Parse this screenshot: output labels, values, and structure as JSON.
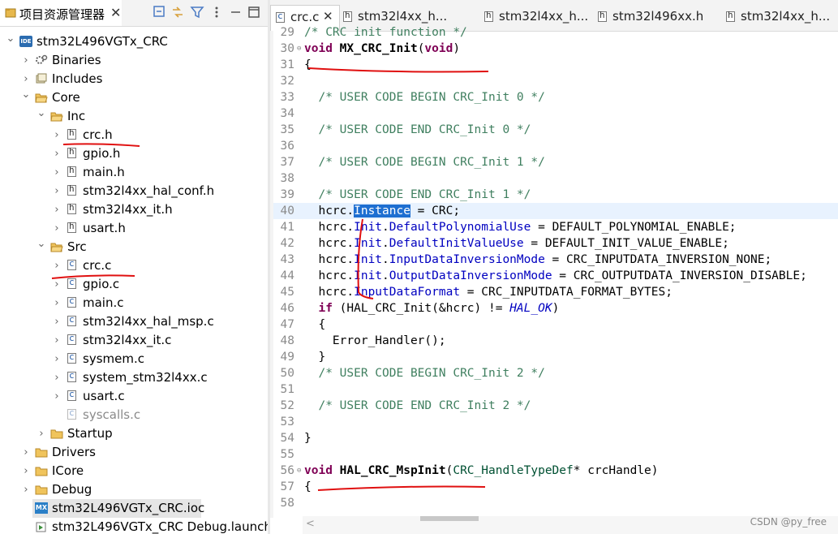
{
  "explorer": {
    "title": "项目资源管理器",
    "close": "✕",
    "tree": [
      {
        "label": "stm32L496VGTx_CRC",
        "icon": "ide",
        "depth": 0,
        "twisty": "v"
      },
      {
        "label": "Binaries",
        "icon": "binaries",
        "depth": 1,
        "twisty": ">"
      },
      {
        "label": "Includes",
        "icon": "includes",
        "depth": 1,
        "twisty": ">"
      },
      {
        "label": "Core",
        "icon": "folder-open",
        "depth": 1,
        "twisty": "v"
      },
      {
        "label": "Inc",
        "icon": "folder-open",
        "depth": 2,
        "twisty": "v"
      },
      {
        "label": "crc.h",
        "icon": "h",
        "depth": 3,
        "twisty": ">"
      },
      {
        "label": "gpio.h",
        "icon": "h",
        "depth": 3,
        "twisty": ">"
      },
      {
        "label": "main.h",
        "icon": "h",
        "depth": 3,
        "twisty": ">"
      },
      {
        "label": "stm32l4xx_hal_conf.h",
        "icon": "h",
        "depth": 3,
        "twisty": ">"
      },
      {
        "label": "stm32l4xx_it.h",
        "icon": "h",
        "depth": 3,
        "twisty": ">"
      },
      {
        "label": "usart.h",
        "icon": "h",
        "depth": 3,
        "twisty": ">"
      },
      {
        "label": "Src",
        "icon": "folder-open",
        "depth": 2,
        "twisty": "v"
      },
      {
        "label": "crc.c",
        "icon": "c",
        "depth": 3,
        "twisty": ">"
      },
      {
        "label": "gpio.c",
        "icon": "c",
        "depth": 3,
        "twisty": ">"
      },
      {
        "label": "main.c",
        "icon": "c",
        "depth": 3,
        "twisty": ">"
      },
      {
        "label": "stm32l4xx_hal_msp.c",
        "icon": "c",
        "depth": 3,
        "twisty": ">"
      },
      {
        "label": "stm32l4xx_it.c",
        "icon": "c",
        "depth": 3,
        "twisty": ">"
      },
      {
        "label": "sysmem.c",
        "icon": "c",
        "depth": 3,
        "twisty": ">"
      },
      {
        "label": "system_stm32l4xx.c",
        "icon": "c",
        "depth": 3,
        "twisty": ">"
      },
      {
        "label": "usart.c",
        "icon": "c",
        "depth": 3,
        "twisty": ">"
      },
      {
        "label": "syscalls.c",
        "icon": "c-excluded",
        "depth": 3,
        "twisty": ""
      },
      {
        "label": "Startup",
        "icon": "folder",
        "depth": 2,
        "twisty": ">"
      },
      {
        "label": "Drivers",
        "icon": "folder",
        "depth": 1,
        "twisty": ">"
      },
      {
        "label": "ICore",
        "icon": "folder",
        "depth": 1,
        "twisty": ">"
      },
      {
        "label": "Debug",
        "icon": "folder",
        "depth": 1,
        "twisty": ">"
      },
      {
        "label": "stm32L496VGTx_CRC.ioc",
        "icon": "mx",
        "depth": 1,
        "twisty": "",
        "selected": true
      },
      {
        "label": "stm32L496VGTx_CRC Debug.launch",
        "icon": "launch",
        "depth": 1,
        "twisty": ""
      }
    ]
  },
  "editor": {
    "tabs": [
      {
        "label": "crc.c",
        "icon": "c",
        "active": true,
        "close": "✕"
      },
      {
        "label": "stm32l4xx_h...",
        "icon": "h"
      },
      {
        "label": "stm32l4xx_h...",
        "icon": "h"
      },
      {
        "label": "stm32l496xx.h",
        "icon": "h"
      },
      {
        "label": "stm32l4xx_h...",
        "icon": "h"
      }
    ],
    "lines": [
      {
        "n": "29",
        "fold": "",
        "segs": [
          [
            "cmt",
            "/* CRC init function */"
          ]
        ]
      },
      {
        "n": "30",
        "fold": "⊖",
        "segs": [
          [
            "kw",
            "void"
          ],
          [
            "",
            " "
          ],
          [
            "fnb",
            "MX_CRC_Init"
          ],
          [
            "",
            "("
          ],
          [
            "kw",
            "void"
          ],
          [
            "",
            ")"
          ]
        ]
      },
      {
        "n": "31",
        "fold": "",
        "segs": [
          [
            "",
            "{"
          ]
        ]
      },
      {
        "n": "32",
        "fold": "",
        "segs": []
      },
      {
        "n": "33",
        "fold": "",
        "segs": [
          [
            "",
            "  "
          ],
          [
            "cmt",
            "/* USER CODE BEGIN CRC_Init 0 */"
          ]
        ]
      },
      {
        "n": "34",
        "fold": "",
        "segs": []
      },
      {
        "n": "35",
        "fold": "",
        "segs": [
          [
            "",
            "  "
          ],
          [
            "cmt",
            "/* USER CODE END CRC_Init 0 */"
          ]
        ]
      },
      {
        "n": "36",
        "fold": "",
        "segs": []
      },
      {
        "n": "37",
        "fold": "",
        "segs": [
          [
            "",
            "  "
          ],
          [
            "cmt",
            "/* USER CODE BEGIN CRC_Init 1 */"
          ]
        ]
      },
      {
        "n": "38",
        "fold": "",
        "segs": []
      },
      {
        "n": "39",
        "fold": "",
        "segs": [
          [
            "",
            "  "
          ],
          [
            "cmt",
            "/* USER CODE END CRC_Init 1 */"
          ]
        ]
      },
      {
        "n": "40",
        "fold": "",
        "current": true,
        "segs": [
          [
            "",
            "  hcrc."
          ],
          [
            "hl",
            "Instance"
          ],
          [
            "",
            " = CRC;"
          ]
        ]
      },
      {
        "n": "41",
        "fold": "",
        "segs": [
          [
            "",
            "  hcrc."
          ],
          [
            "fld",
            "Init"
          ],
          [
            "",
            "."
          ],
          [
            "fld",
            "DefaultPolynomialUse"
          ],
          [
            "",
            " = DEFAULT_POLYNOMIAL_ENABLE;"
          ]
        ]
      },
      {
        "n": "42",
        "fold": "",
        "segs": [
          [
            "",
            "  hcrc."
          ],
          [
            "fld",
            "Init"
          ],
          [
            "",
            "."
          ],
          [
            "fld",
            "DefaultInitValueUse"
          ],
          [
            "",
            " = DEFAULT_INIT_VALUE_ENABLE;"
          ]
        ]
      },
      {
        "n": "43",
        "fold": "",
        "segs": [
          [
            "",
            "  hcrc."
          ],
          [
            "fld",
            "Init"
          ],
          [
            "",
            "."
          ],
          [
            "fld",
            "InputDataInversionMode"
          ],
          [
            "",
            " = CRC_INPUTDATA_INVERSION_NONE;"
          ]
        ]
      },
      {
        "n": "44",
        "fold": "",
        "segs": [
          [
            "",
            "  hcrc."
          ],
          [
            "fld",
            "Init"
          ],
          [
            "",
            "."
          ],
          [
            "fld",
            "OutputDataInversionMode"
          ],
          [
            "",
            " = CRC_OUTPUTDATA_INVERSION_DISABLE;"
          ]
        ]
      },
      {
        "n": "45",
        "fold": "",
        "segs": [
          [
            "",
            "  hcrc."
          ],
          [
            "fld",
            "InputDataFormat"
          ],
          [
            "",
            " = CRC_INPUTDATA_FORMAT_BYTES;"
          ]
        ]
      },
      {
        "n": "46",
        "fold": "",
        "segs": [
          [
            "",
            "  "
          ],
          [
            "kw",
            "if"
          ],
          [
            "",
            " (HAL_CRC_Init(&hcrc) != "
          ],
          [
            "hal",
            "HAL_OK"
          ],
          [
            "",
            ")"
          ]
        ]
      },
      {
        "n": "47",
        "fold": "",
        "segs": [
          [
            "",
            "  {"
          ]
        ]
      },
      {
        "n": "48",
        "fold": "",
        "segs": [
          [
            "",
            "    Error_Handler();"
          ]
        ]
      },
      {
        "n": "49",
        "fold": "",
        "segs": [
          [
            "",
            "  }"
          ]
        ]
      },
      {
        "n": "50",
        "fold": "",
        "segs": [
          [
            "",
            "  "
          ],
          [
            "cmt",
            "/* USER CODE BEGIN CRC_Init 2 */"
          ]
        ]
      },
      {
        "n": "51",
        "fold": "",
        "segs": []
      },
      {
        "n": "52",
        "fold": "",
        "segs": [
          [
            "",
            "  "
          ],
          [
            "cmt",
            "/* USER CODE END CRC_Init 2 */"
          ]
        ]
      },
      {
        "n": "53",
        "fold": "",
        "segs": []
      },
      {
        "n": "54",
        "fold": "",
        "segs": [
          [
            "",
            "}"
          ]
        ]
      },
      {
        "n": "55",
        "fold": "",
        "segs": []
      },
      {
        "n": "56",
        "fold": "⊖",
        "segs": [
          [
            "kw",
            "void"
          ],
          [
            "",
            " "
          ],
          [
            "fnb",
            "HAL_CRC_MspInit"
          ],
          [
            "",
            "("
          ],
          [
            "typ",
            "CRC_HandleTypeDef"
          ],
          [
            "",
            "* crcHandle)"
          ]
        ]
      },
      {
        "n": "57",
        "fold": "",
        "segs": [
          [
            "",
            "{"
          ]
        ]
      },
      {
        "n": "58",
        "fold": "",
        "segs": []
      }
    ]
  },
  "watermark": "CSDN @py_free"
}
